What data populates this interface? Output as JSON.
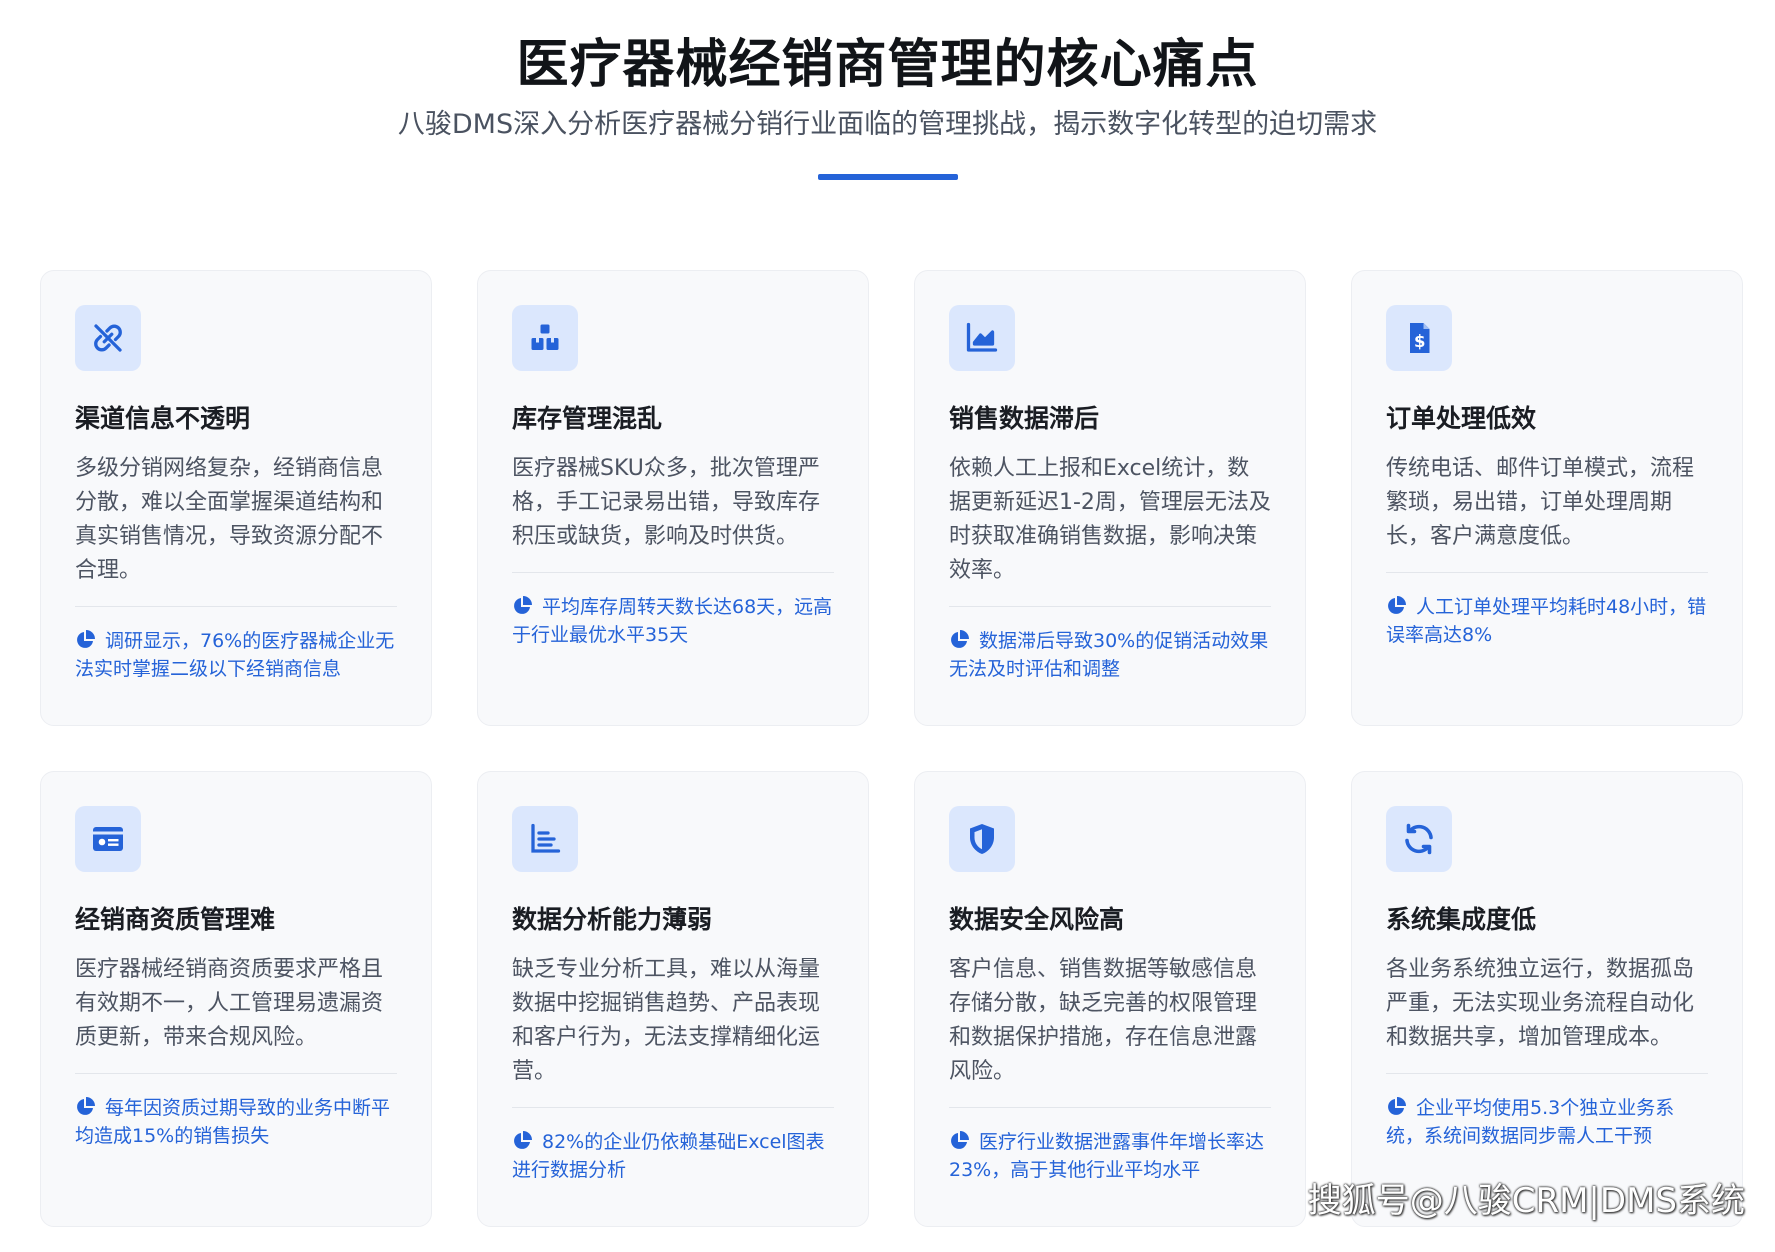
{
  "header": {
    "title": "医疗器械经销商管理的核心痛点",
    "subtitle": "八骏DMS深入分析医疗器械分销行业面临的管理挑战，揭示数字化转型的迫切需求"
  },
  "colors": {
    "accent": "#2563d8",
    "icon_bg": "#dbe7fd",
    "card_bg": "#f8f9fb"
  },
  "cards": [
    {
      "icon": "link-broken-icon",
      "title": "渠道信息不透明",
      "desc": "多级分销网络复杂，经销商信息分散，难以全面掌握渠道结构和真实销售情况，导致资源分配不合理。",
      "stat": "调研显示，76%的医疗器械企业无法实时掌握二级以下经销商信息"
    },
    {
      "icon": "boxes-icon",
      "title": "库存管理混乱",
      "desc": "医疗器械SKU众多，批次管理严格，手工记录易出错，导致库存积压或缺货，影响及时供货。",
      "stat": "平均库存周转天数长达68天，远高于行业最优水平35天"
    },
    {
      "icon": "area-chart-icon",
      "title": "销售数据滞后",
      "desc": "依赖人工上报和Excel统计，数据更新延迟1-2周，管理层无法及时获取准确销售数据，影响决策效率。",
      "stat": "数据滞后导致30%的促销活动效果无法及时评估和调整"
    },
    {
      "icon": "invoice-dollar-icon",
      "title": "订单处理低效",
      "desc": "传统电话、邮件订单模式，流程繁琐，易出错，订单处理周期长，客户满意度低。",
      "stat": "人工订单处理平均耗时48小时，错误率高达8%"
    },
    {
      "icon": "id-card-icon",
      "title": "经销商资质管理难",
      "desc": "医疗器械经销商资质要求严格且有效期不一，人工管理易遗漏资质更新，带来合规风险。",
      "stat": "每年因资质过期导致的业务中断平均造成15%的销售损失"
    },
    {
      "icon": "bar-chart-icon",
      "title": "数据分析能力薄弱",
      "desc": "缺乏专业分析工具，难以从海量数据中挖掘销售趋势、产品表现和客户行为，无法支撑精细化运营。",
      "stat": "82%的企业仍依赖基础Excel图表进行数据分析"
    },
    {
      "icon": "shield-icon",
      "title": "数据安全风险高",
      "desc": "客户信息、销售数据等敏感信息存储分散，缺乏完善的权限管理和数据保护措施，存在信息泄露风险。",
      "stat": "医疗行业数据泄露事件年增长率达23%，高于其他行业平均水平"
    },
    {
      "icon": "sync-icon",
      "title": "系统集成度低",
      "desc": "各业务系统独立运行，数据孤岛严重，无法实现业务流程自动化和数据共享，增加管理成本。",
      "stat": "企业平均使用5.3个独立业务系统，系统间数据同步需人工干预"
    }
  ],
  "watermark": "搜狐号@八骏CRM|DMS系统"
}
